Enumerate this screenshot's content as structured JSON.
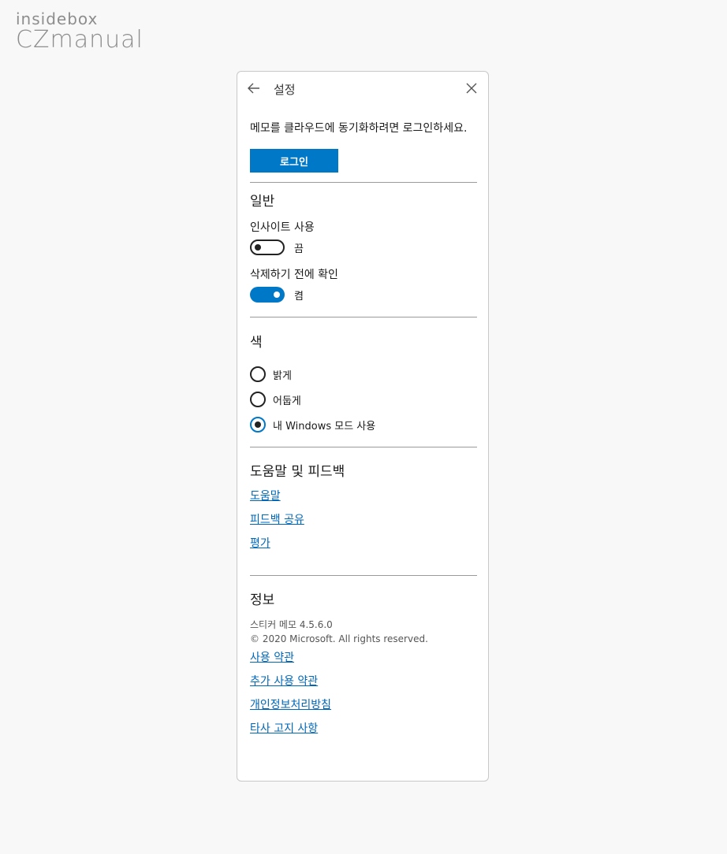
{
  "watermark": {
    "top": "insidebox",
    "bottom": "CZmanual"
  },
  "window": {
    "title": "설정",
    "back_icon": "arrow-left-icon",
    "close_icon": "close-icon"
  },
  "account": {
    "sync_text": "메모를 클라우드에 동기화하려면 로그인하세요.",
    "login_label": "로그인"
  },
  "general": {
    "title": "일반",
    "insights": {
      "label": "인사이트 사용",
      "state_label": "끔",
      "on": false
    },
    "confirm_delete": {
      "label": "삭제하기 전에 확인",
      "state_label": "켬",
      "on": true
    }
  },
  "color": {
    "title": "색",
    "options": [
      {
        "label": "밝게",
        "selected": false
      },
      {
        "label": "어둡게",
        "selected": false
      },
      {
        "label": "내 Windows 모드 사용",
        "selected": true
      }
    ]
  },
  "help": {
    "title": "도움말 및 피드백",
    "links": [
      "도움말",
      "피드백 공유",
      "평가"
    ]
  },
  "about": {
    "title": "정보",
    "version": "스티커 메모 4.5.6.0",
    "copyright": "© 2020 Microsoft. All rights reserved.",
    "links": [
      "사용 약관",
      "추가 사용 약관",
      "개인정보처리방침",
      "타사 고지 사항"
    ]
  },
  "colors": {
    "accent": "#0078c8",
    "link": "#0067b8",
    "background": "#f8f8f8"
  }
}
